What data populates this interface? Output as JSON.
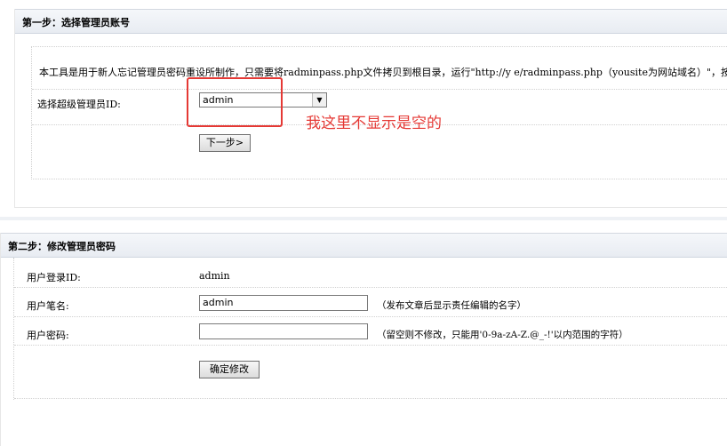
{
  "step1": {
    "title": "第一步：选择管理员账号",
    "description": "本工具是用于新人忘记管理员密码重设所制作，只需要将radminpass.php文件拷贝到根目录，运行\"http://y    e/radminpass.php（yousite为网站域名）\"，按照操作",
    "select_label": "选择超级管理员ID:",
    "select_value": "admin",
    "next_button": "下一步>"
  },
  "annotation": {
    "text": "我这里不显示是空的",
    "color": "#e53935"
  },
  "step2": {
    "title": "第二步：修改管理员密码",
    "login_id_label": "用户登录ID:",
    "login_id_value": "admin",
    "pen_name_label": "用户笔名:",
    "pen_name_value": "admin",
    "pen_name_hint": "（发布文章后显示责任编辑的名字）",
    "password_label": "用户密码:",
    "password_value": "",
    "password_hint": "（留空则不修改，只能用'0-9a-zA-Z.@_-!'以内范围的字符）",
    "confirm_button": "确定修改"
  }
}
